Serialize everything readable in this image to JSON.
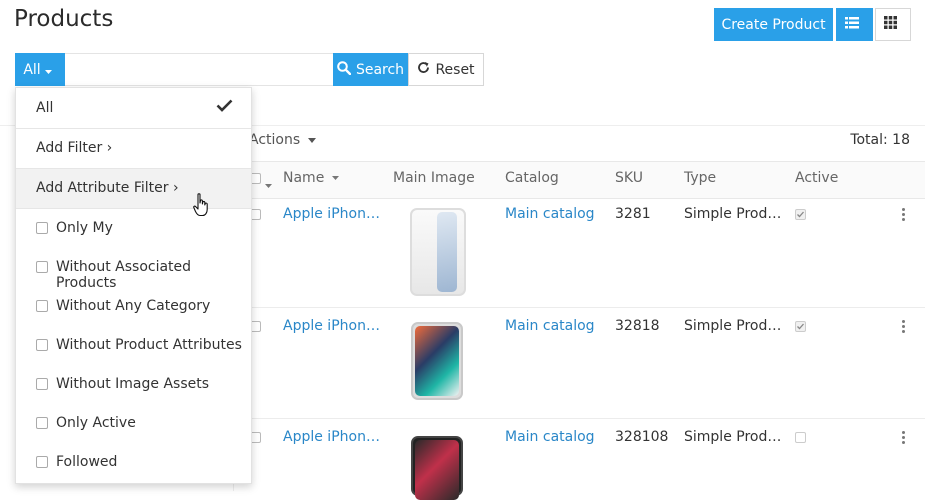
{
  "page": {
    "title": "Products"
  },
  "header": {
    "create_label": "Create Product",
    "list_view_icon": "list-view-icon",
    "grid_view_icon": "grid-view-icon",
    "accent": "#2aa0e8"
  },
  "search": {
    "scope_label": "All",
    "query": "",
    "placeholder": "",
    "search_label": "Search",
    "reset_label": "Reset"
  },
  "list": {
    "actions_label": "Actions",
    "total_label": "Total: 18",
    "columns": [
      "Name",
      "Main Image",
      "Catalog",
      "SKU",
      "Type",
      "Active"
    ],
    "rows": [
      {
        "name": "Apple iPhon…",
        "catalog": "Main catalog",
        "sku": "3281",
        "type": "Simple Prod…",
        "active": true
      },
      {
        "name": "Apple iPhon…",
        "catalog": "Main catalog",
        "sku": "32818",
        "type": "Simple Prod…",
        "active": true
      },
      {
        "name": "Apple iPhon…",
        "catalog": "Main catalog",
        "sku": "328108",
        "type": "Simple Prod…",
        "active": false
      }
    ]
  },
  "filter_menu": {
    "all_label": "All",
    "add_filter_label": "Add Filter ›",
    "add_attribute_filter_label": "Add Attribute Filter ›",
    "options": [
      "Only My",
      "Without Associated Products",
      "Without Any Category",
      "Without Product Attributes",
      "Without Image Assets",
      "Only Active",
      "Followed"
    ]
  }
}
